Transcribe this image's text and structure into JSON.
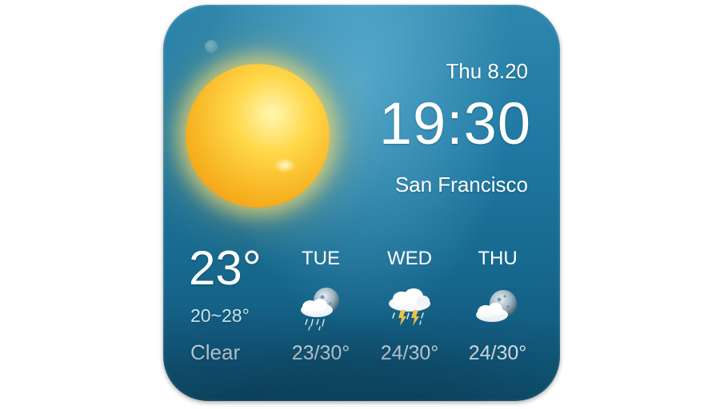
{
  "current": {
    "date": "Thu 8.20",
    "time": "19:30",
    "city": "San Francisco",
    "temperature": "23°",
    "range": "20~28°",
    "condition": "Clear",
    "icon": "sun-icon"
  },
  "forecast": [
    {
      "day": "TUE",
      "range": "23/30°",
      "icon": "moon-cloud-rain-icon"
    },
    {
      "day": "WED",
      "range": "24/30°",
      "icon": "cloud-thunderstorm-icon"
    },
    {
      "day": "THU",
      "range": "24/30°",
      "icon": "moon-cloud-icon"
    }
  ],
  "colors": {
    "background_top": "#2f86ad",
    "background_bottom": "#0f5275",
    "sun": "#f7b321",
    "text": "#ffffff"
  }
}
